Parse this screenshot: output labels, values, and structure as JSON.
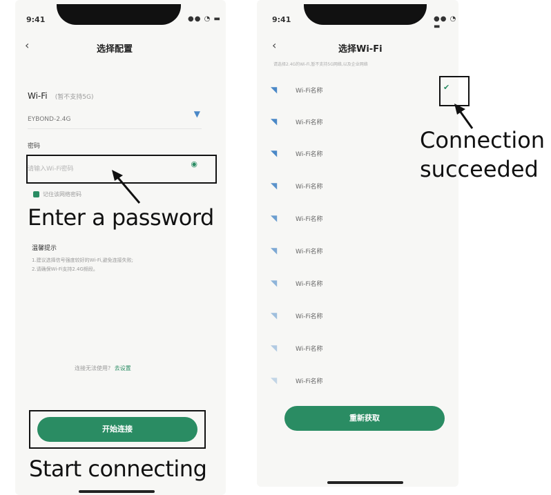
{
  "left_screen": {
    "status_time": "9:41",
    "status_icons": "●● ◔ ▬",
    "back_icon": "‹",
    "title": "选择配置",
    "wifi_label": "Wi-Fi",
    "wifi_hint": "(暂不支持5G)",
    "wifi_value": "EYBOND-2.4G",
    "password_label": "密码",
    "password_placeholder": "请输入Wi-Fi密码",
    "remember_label": "记住该网络密码",
    "tips_title": "温馨提示",
    "tips_line1": "1.建议选择信号强度较好的Wi-Fi,避免连接失败;",
    "tips_line2": "2.请确保Wi-Fi支持2.4G频段。",
    "help_text": "连接无法使用?",
    "help_link": "去设置",
    "connect_button": "开始连接"
  },
  "right_screen": {
    "status_time": "9:41",
    "status_icons": "●● ◔ ▬",
    "back_icon": "‹",
    "title": "选择Wi-Fi",
    "subtitle": "请选择2.4G的Wi-Fi,暂不支持5G网络,以及企业网络",
    "wifi_item_label": "Wi-Fi名称",
    "wifi_items": [
      "Wi-Fi名称",
      "Wi-Fi名称",
      "Wi-Fi名称",
      "Wi-Fi名称",
      "Wi-Fi名称",
      "Wi-Fi名称",
      "Wi-Fi名称",
      "Wi-Fi名称",
      "Wi-Fi名称",
      "Wi-Fi名称"
    ],
    "check_icon": "✔",
    "refresh_button": "重新获取"
  },
  "annotations": {
    "enter_password": "Enter a password",
    "start_connecting": "Start connecting",
    "connection_succeeded_line1": "Connection",
    "connection_succeeded_line2": "succeeded"
  },
  "colors": {
    "accent": "#2a8c63",
    "wifi_icon": "#4a88c7"
  }
}
